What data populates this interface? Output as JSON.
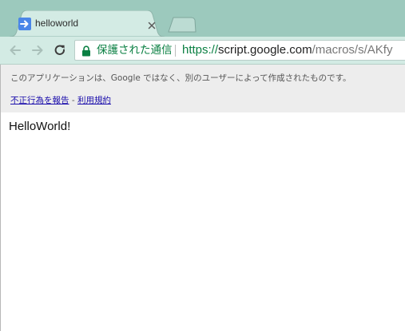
{
  "tab": {
    "title": "helloworld",
    "favicon": "apps-script-arrow-icon",
    "close": "close-icon"
  },
  "toolbar": {
    "back": "back-arrow-icon",
    "forward": "forward-arrow-icon",
    "reload": "reload-icon"
  },
  "omnibox": {
    "security_icon": "lock-icon",
    "security_label": "保護された通信",
    "url_scheme": "https://",
    "url_host": "script.google.com",
    "url_path": "/macros/s/AKfy"
  },
  "warning": {
    "message": "このアプリケーションは、Google ではなく、別のユーザーによって作成されたものです。",
    "report_link": "不正行為を報告",
    "separator": " - ",
    "terms_link": "利用規約"
  },
  "page": {
    "body_text": "HelloWorld!"
  },
  "colors": {
    "frame": "#9cc9bd",
    "toolbar": "#d3ebe4",
    "secure_green": "#0b8043",
    "favicon_blue": "#4a86e8",
    "link": "#1a0dab"
  }
}
